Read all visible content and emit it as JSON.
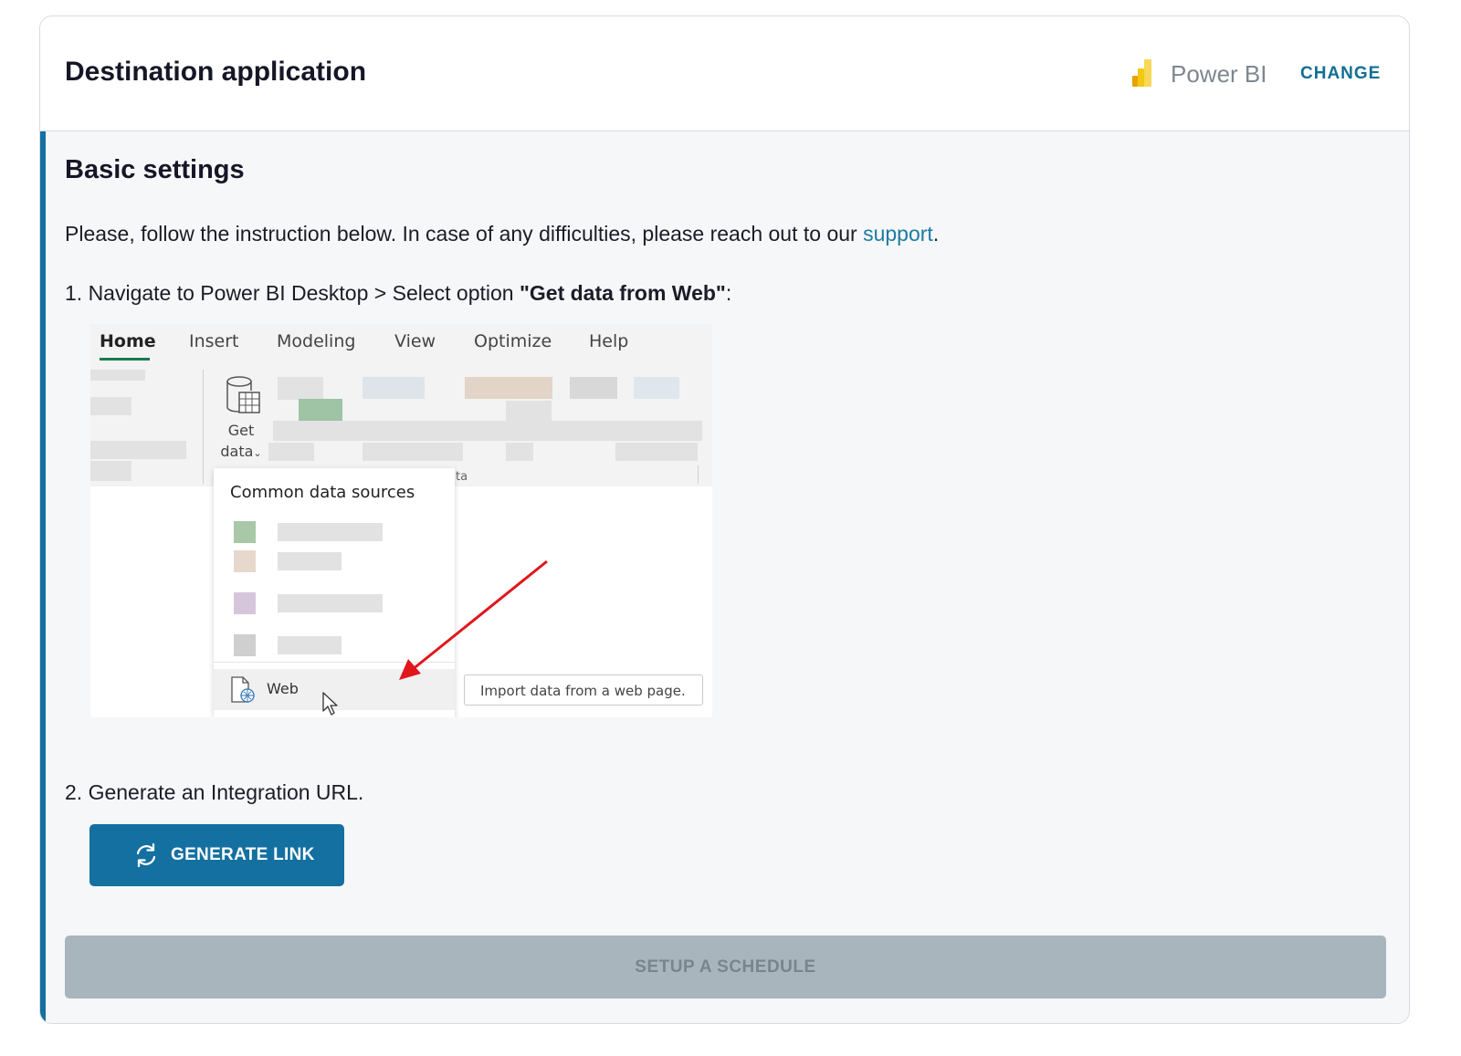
{
  "header": {
    "title": "Destination application",
    "app_name": "Power BI",
    "change_label": "CHANGE",
    "colors": {
      "accent": "#1470a0",
      "logo_yellow": "#f2c811"
    }
  },
  "settings": {
    "title": "Basic settings",
    "intro_text": "Please, follow the instruction below. In case of any difficulties, please reach out to our ",
    "support_link": "support",
    "intro_end": ".",
    "step1_prefix": "1. Navigate to Power BI Desktop > Select option ",
    "step1_bold": "\"Get data from Web\"",
    "step1_suffix": ":",
    "step2": "2. Generate an Integration URL.",
    "generate_button": "GENERATE LINK",
    "schedule_button": "SETUP A SCHEDULE"
  },
  "screenshot": {
    "tabs": [
      "Home",
      "Insert",
      "Modeling",
      "View",
      "Optimize",
      "Help"
    ],
    "active_tab": "Home",
    "get_data_line1": "Get",
    "get_data_line2": "data",
    "group_label_fragment": "ta",
    "dropdown_title": "Common data sources",
    "web_item": "Web",
    "tooltip": "Import data from a web page."
  }
}
